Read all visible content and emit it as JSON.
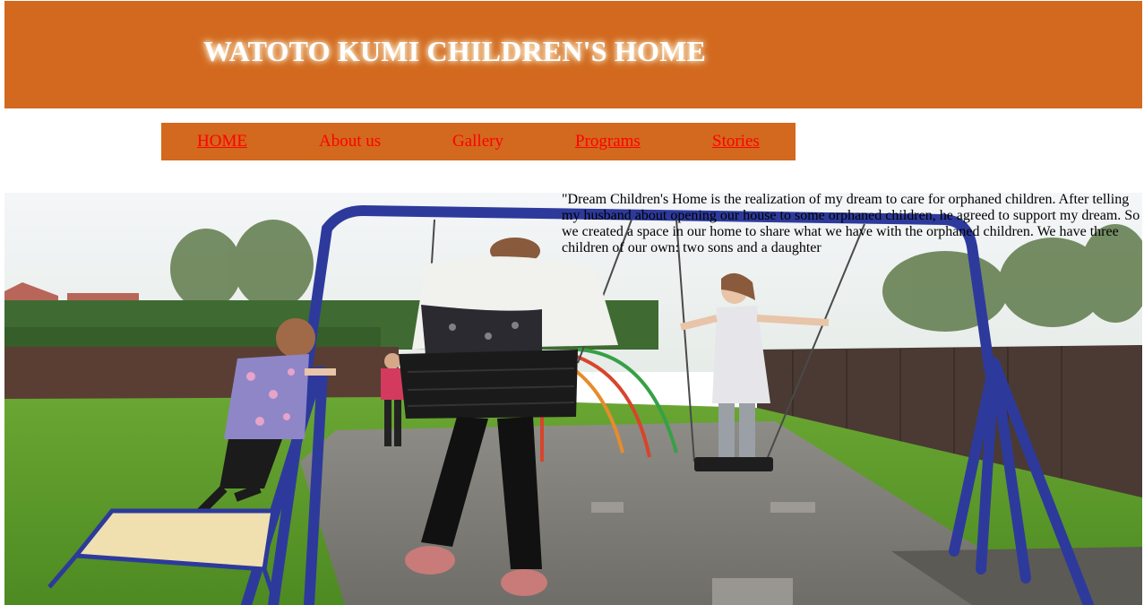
{
  "site": {
    "title": "WATOTO KUMI CHILDREN'S HOME"
  },
  "nav": {
    "items": [
      {
        "label": "HOME",
        "underlined": true
      },
      {
        "label": "About us",
        "underlined": false
      },
      {
        "label": "Gallery",
        "underlined": false
      },
      {
        "label": "Programs",
        "underlined": true
      },
      {
        "label": "Stories",
        "underlined": true
      }
    ]
  },
  "content": {
    "quote": "\"Dream Children's Home is the realization of my dream to care for orphaned children. After telling my husband about opening our house to some orphaned children, he agreed to support my dream. So we created a space in our home to share what we have with the orphaned children. We have three children of our own: two sons and a daughter"
  },
  "colors": {
    "brand": "#d2691e",
    "link": "#ff0000",
    "title": "#ffffff"
  }
}
